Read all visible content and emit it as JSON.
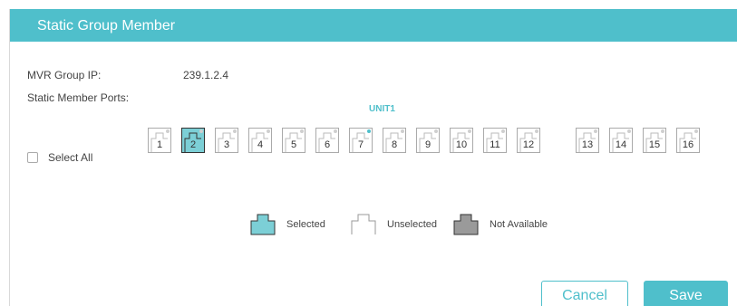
{
  "header": {
    "title": "Static Group Member"
  },
  "form": {
    "mvr_group_ip_label": "MVR Group IP:",
    "mvr_group_ip_value": "239.1.2.4",
    "static_member_ports_label": "Static Member Ports:"
  },
  "unit_label": "UNIT1",
  "select_all_label": "Select All",
  "ports": [
    {
      "num": "1",
      "state": "unselected"
    },
    {
      "num": "2",
      "state": "selected"
    },
    {
      "num": "3",
      "state": "unselected"
    },
    {
      "num": "4",
      "state": "unselected"
    },
    {
      "num": "5",
      "state": "unselected"
    },
    {
      "num": "6",
      "state": "unselected"
    },
    {
      "num": "7",
      "state": "unselected",
      "link_up": true
    },
    {
      "num": "8",
      "state": "unselected"
    },
    {
      "num": "9",
      "state": "unselected"
    },
    {
      "num": "10",
      "state": "unselected"
    },
    {
      "num": "11",
      "state": "unselected"
    },
    {
      "num": "12",
      "state": "unselected"
    },
    {
      "num": "13",
      "state": "unselected"
    },
    {
      "num": "14",
      "state": "unselected"
    },
    {
      "num": "15",
      "state": "unselected"
    },
    {
      "num": "16",
      "state": "unselected"
    }
  ],
  "legend": {
    "selected": "Selected",
    "unselected": "Unselected",
    "not_available": "Not Available"
  },
  "buttons": {
    "cancel": "Cancel",
    "save": "Save"
  },
  "colors": {
    "accent": "#4fbfcb",
    "selected_fill": "#7ccfd6",
    "not_available_fill": "#9a9a9a",
    "link_led": "#4fbfcb"
  }
}
